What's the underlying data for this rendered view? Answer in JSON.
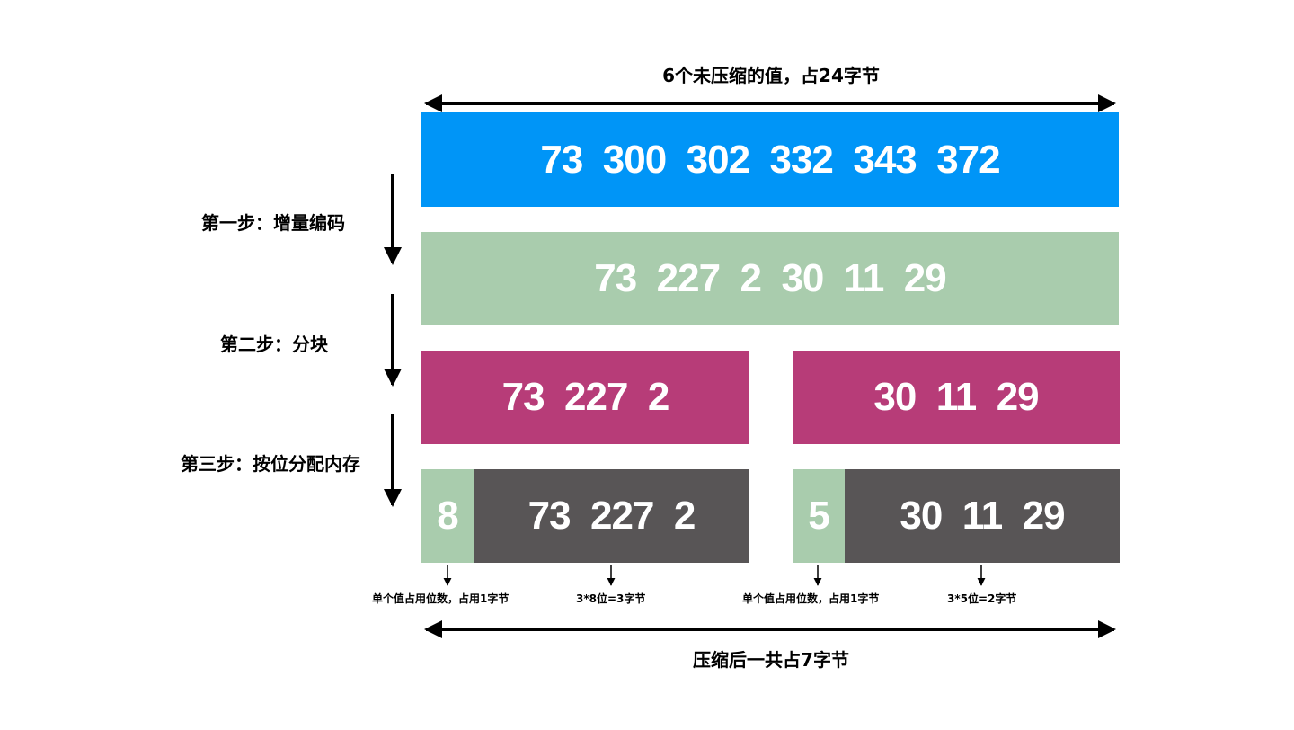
{
  "top_label": "6个未压缩的值，占24字节",
  "bottom_label": "压缩后一共占7字节",
  "steps": {
    "step1": "第一步：增量编码",
    "step2": "第二步：分块",
    "step3": "第三步：按位分配内存"
  },
  "rows": {
    "original": "73  300  302  332  343  372",
    "delta": "73  227  2  30  11  29",
    "block_left": "73  227  2",
    "block_right": "30  11  29",
    "packed_left": {
      "bits": "8",
      "values": "73  227  2"
    },
    "packed_right": {
      "bits": "5",
      "values": "30  11  29"
    }
  },
  "captions": {
    "left_bits": "单个值占用位数，占用1字节",
    "left_values": "3*8位=3字节",
    "right_bits": "单个值占用位数，占用1字节",
    "right_values": "3*5位=2字节"
  },
  "colors": {
    "blue": "#0095F7",
    "green": "#A9CCAD",
    "magenta": "#B73C78",
    "gray": "#585556"
  }
}
